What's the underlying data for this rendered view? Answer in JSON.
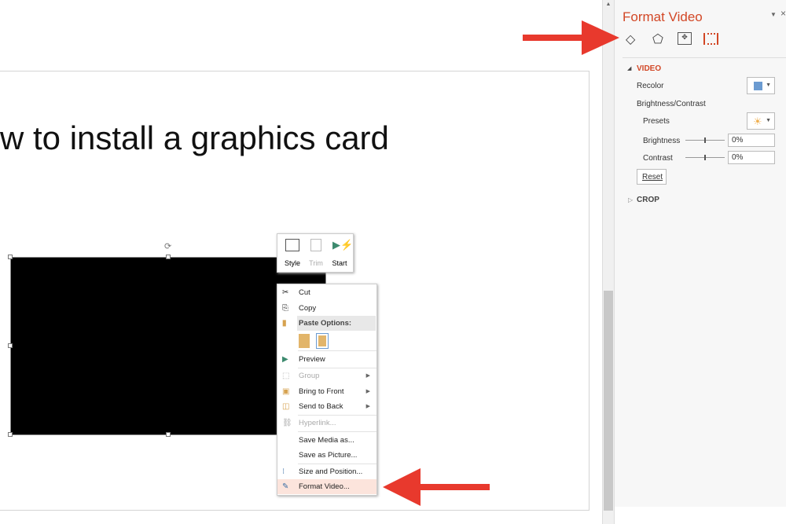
{
  "slide": {
    "title": "w to install a graphics card"
  },
  "mini_toolbar": {
    "items": [
      {
        "label": "Style",
        "icon": "video-style-icon"
      },
      {
        "label": "Trim",
        "icon": "trim-icon",
        "disabled": true
      },
      {
        "label": "Start",
        "icon": "start-icon"
      }
    ]
  },
  "context_menu": {
    "items": [
      {
        "label": "Cut",
        "icon": "scissors-icon"
      },
      {
        "label": "Copy",
        "icon": "copy-icon"
      },
      {
        "label": "Paste Options:",
        "icon": "paste-icon",
        "header": true
      },
      {
        "label": "Preview",
        "icon": "play-icon"
      },
      {
        "label": "Group",
        "icon": "group-icon",
        "disabled": true,
        "submenu": true
      },
      {
        "label": "Bring to Front",
        "icon": "bring-front-icon",
        "submenu": true
      },
      {
        "label": "Send to Back",
        "icon": "send-back-icon",
        "submenu": true
      },
      {
        "label": "Hyperlink...",
        "icon": "link-icon",
        "disabled": true
      },
      {
        "label": "Save Media as..."
      },
      {
        "label": "Save as Picture..."
      },
      {
        "label": "Size and Position...",
        "icon": "size-icon"
      },
      {
        "label": "Format Video...",
        "icon": "format-icon",
        "highlighted": true
      }
    ]
  },
  "panel": {
    "title": "Format Video",
    "tabs": [
      "fill-line-icon",
      "effects-icon",
      "size-properties-icon",
      "video-icon"
    ],
    "video_section": "VIDEO",
    "recolor": "Recolor",
    "brightness_contrast": "Brightness/Contrast",
    "presets": "Presets",
    "brightness": {
      "label": "Brightness",
      "value": "0%"
    },
    "contrast": {
      "label": "Contrast",
      "value": "0%"
    },
    "reset": "Reset",
    "crop_section": "CROP"
  },
  "colors": {
    "accent": "#d24726",
    "arrow": "#e8392d",
    "highlight": "#fce4dc"
  }
}
